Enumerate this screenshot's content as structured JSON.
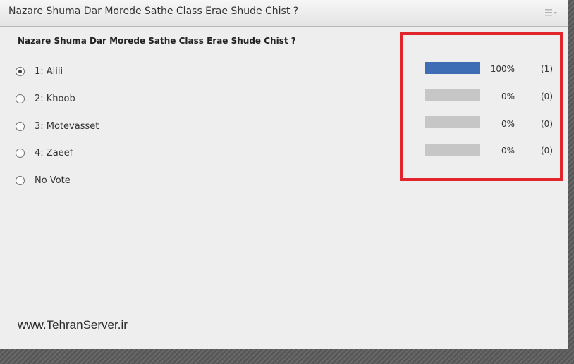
{
  "pod": {
    "title": "Nazare Shuma Dar Morede Sathe Class Erae Shude Chist ?",
    "menu_icon": "pod-menu-icon"
  },
  "poll": {
    "question": "Nazare Shuma Dar Morede Sathe Class Erae Shude Chist ?",
    "options": [
      {
        "label": "1: Aliii",
        "selected": true
      },
      {
        "label": "2: Khoob",
        "selected": false
      },
      {
        "label": "3: Motevasset",
        "selected": false
      },
      {
        "label": "4: Zaeef",
        "selected": false
      },
      {
        "label": "No Vote",
        "selected": false
      }
    ],
    "results": [
      {
        "percent": "100%",
        "count": "(1)",
        "fraction": 1.0
      },
      {
        "percent": "0%",
        "count": "(0)",
        "fraction": 0
      },
      {
        "percent": "0%",
        "count": "(0)",
        "fraction": 0
      },
      {
        "percent": "0%",
        "count": "(0)",
        "fraction": 0
      }
    ]
  },
  "colors": {
    "bar_fill": "#3f6db5",
    "bar_track": "#c6c6c6",
    "highlight_border": "#e0262c"
  },
  "watermark": "www.TehranServer.ir"
}
